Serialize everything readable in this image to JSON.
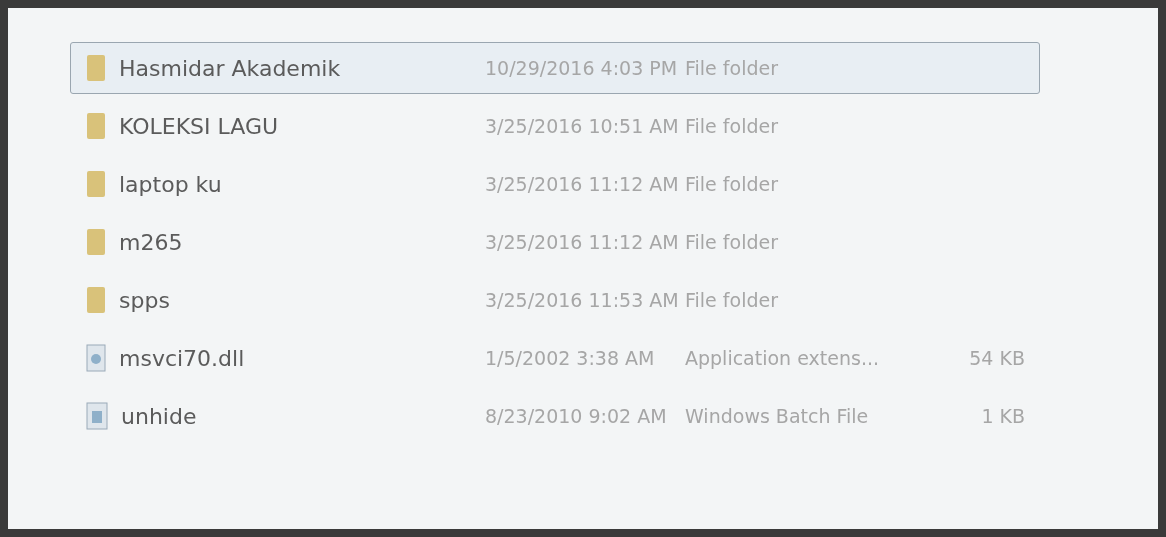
{
  "files": [
    {
      "name": "Hasmidar Akademik",
      "modified": "10/29/2016 4:03 PM",
      "type": "File folder",
      "kind": "folder",
      "selected": true
    },
    {
      "name": "KOLEKSI LAGU",
      "modified": "3/25/2016 10:51 AM",
      "type": "File folder",
      "kind": "folder",
      "selected": false
    },
    {
      "name": "laptop ku",
      "modified": "3/25/2016 11:12 AM",
      "type": "File folder",
      "kind": "folder",
      "selected": false
    },
    {
      "name": "m265",
      "modified": "3/25/2016 11:12 AM",
      "type": "File folder",
      "kind": "folder",
      "selected": false
    },
    {
      "name": "spps",
      "modified": "3/25/2016 11:53 AM",
      "type": "File folder",
      "kind": "folder",
      "selected": false
    },
    {
      "name": "msvci70.dll",
      "modified": "1/5/2002 3:38 AM",
      "type": "Application extens...",
      "size": "54 KB",
      "kind": "dll",
      "selected": false
    },
    {
      "name": "unhide",
      "modified": "8/23/2010 9:02 AM",
      "type": "Windows Batch File",
      "size": "1 KB",
      "kind": "batch",
      "selected": false
    }
  ]
}
